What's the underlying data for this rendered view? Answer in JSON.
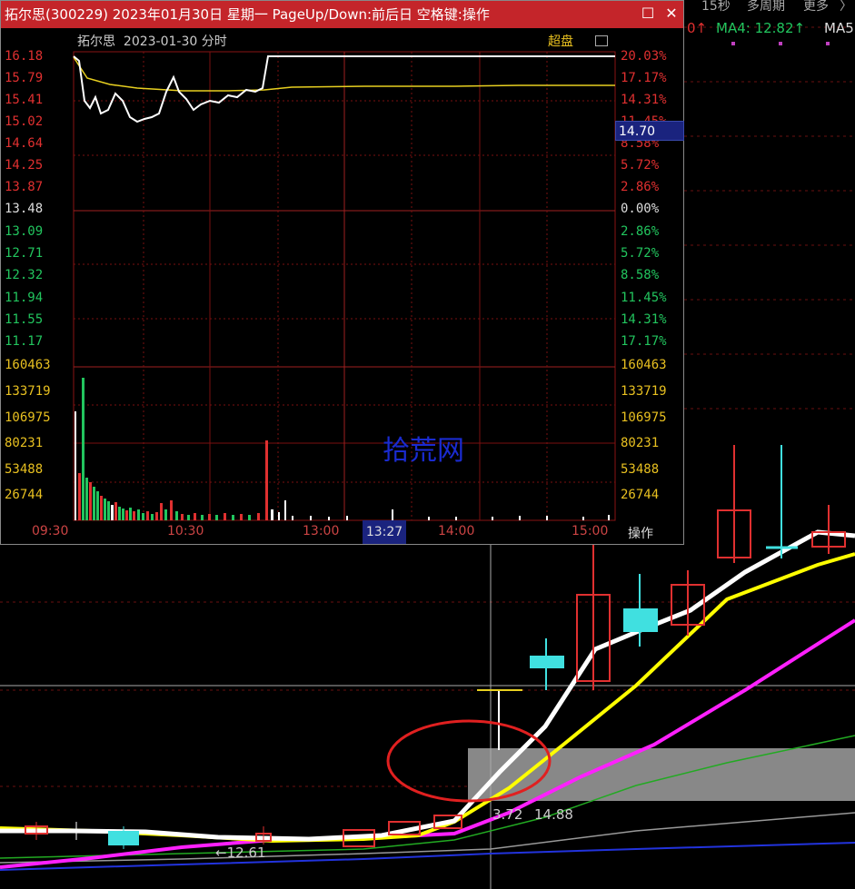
{
  "window": {
    "title": "拓尔思(300229) 2023年01月30日 星期一 PageUp/Down:前后日 空格键:操作",
    "restore_icon": "restore-icon",
    "close_icon": "close-icon"
  },
  "toolbar": {
    "period": "15秒",
    "multi_period": "多周期",
    "more": "更多",
    "ma_partial": "0↑",
    "ma4": "MA4: 12.82↑",
    "ma5": "MA5"
  },
  "intraday": {
    "name": "拓尔思",
    "date": "2023-01-30",
    "mode": "分时",
    "super": "超盘",
    "price_axis": [
      "16.18",
      "15.79",
      "15.41",
      "15.02",
      "14.64",
      "14.25",
      "13.87",
      "13.48",
      "13.09",
      "12.71",
      "12.32",
      "11.94",
      "11.55",
      "11.17"
    ],
    "pct_axis": [
      "20.03%",
      "17.17%",
      "14.31%",
      "11.45%",
      "8.58%",
      "5.72%",
      "2.86%",
      "0.00%",
      "2.86%",
      "5.72%",
      "8.58%",
      "11.45%",
      "14.31%",
      "17.17%"
    ],
    "volume_axis": [
      "160463",
      "133719",
      "106975",
      "80231",
      "53488",
      "26744"
    ],
    "time_axis": [
      "09:30",
      "10:30",
      "13:00",
      "14:00",
      "15:00"
    ],
    "cursor_time": "13:27",
    "cursor_price": "14.70",
    "action_button": "操作",
    "watermark": "拾荒网",
    "colors": {
      "up": "#e03030",
      "down": "#22c55e",
      "price": "#ffffff",
      "avg": "#e8d020"
    }
  },
  "kline": {
    "labels": {
      "low_mark": "←12.61",
      "box_left": "3.72",
      "box_right": "14.88"
    },
    "colors": {
      "ma_white": "#ffffff",
      "ma_yellow": "#ffff00",
      "ma_magenta": "#ff20ff",
      "ma_green": "#22aa22",
      "ma_gray": "#999999",
      "ma_blue": "#2233dd",
      "candle_up": "#e03030",
      "candle_down": "#40e0e0"
    }
  }
}
